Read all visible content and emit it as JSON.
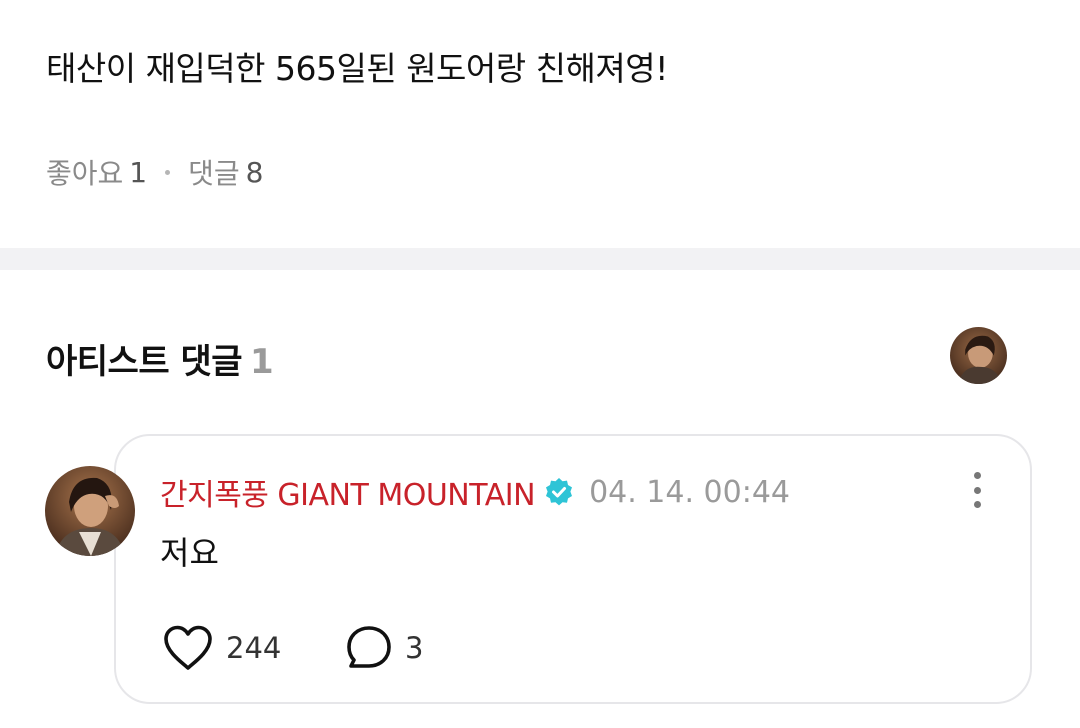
{
  "post": {
    "text": "태산이 재입덕한 565일된 원도어랑 친해져영!",
    "likes_label": "좋아요",
    "likes_count": "1",
    "comments_label": "댓글",
    "comments_count": "8"
  },
  "artist_comments": {
    "title": "아티스트 댓글",
    "count": "1"
  },
  "comment": {
    "author": "간지폭풍 GIANT MOUNTAIN",
    "date": "04. 14. 00:44",
    "body": "저요",
    "like_count": "244",
    "reply_count": "3",
    "verified_color": "#2ec4d6",
    "author_color": "#c8222a"
  },
  "icons": {
    "more": "more-vertical-icon",
    "verified": "verified-badge-icon",
    "like": "heart-icon",
    "reply": "speech-bubble-icon"
  }
}
